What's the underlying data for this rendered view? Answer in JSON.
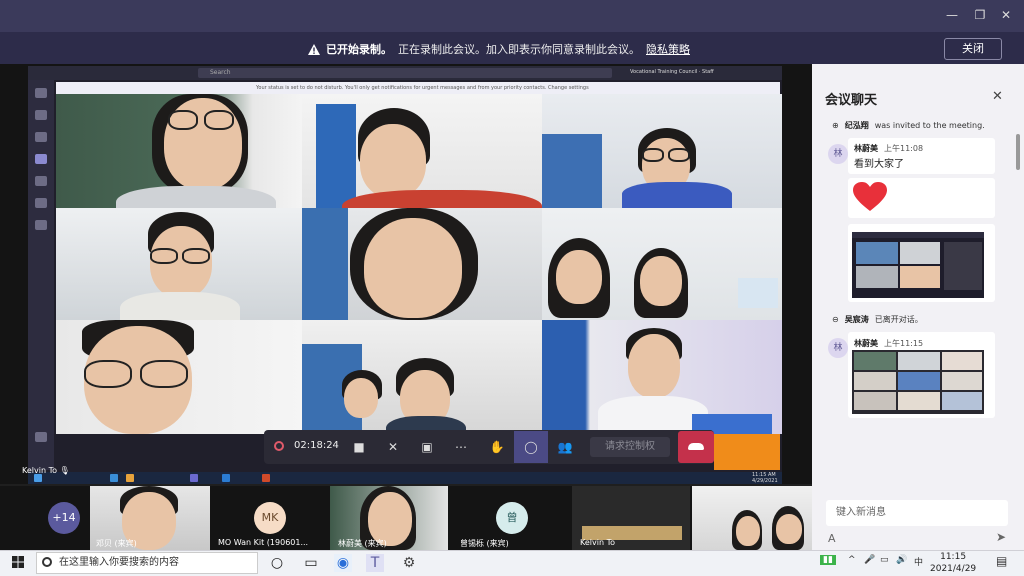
{
  "window": {
    "minimize_icon": "minimize-icon",
    "maximize_icon": "maximize-icon",
    "close_icon": "close-icon"
  },
  "recording_banner": {
    "status": "已开始录制。",
    "message": "正在录制此会议。加入即表示你同意录制此会议。",
    "link": "隐私策略",
    "close_label": "关闭"
  },
  "shared_screen": {
    "search_placeholder": "Search",
    "title": "Vocational Training Council · Staff",
    "notice": "Your status is set to do not disturb. You'll only get notifications for urgent messages and from your priority contacts. Change settings"
  },
  "call": {
    "timer": "02:18:24",
    "request_control_label": "请求控制权",
    "local_user": "Kelvin To"
  },
  "mini_taskbar": {
    "time": "11:15 AM",
    "date": "4/29/2021"
  },
  "gallery": {
    "overflow_count": "+14",
    "participants": [
      {
        "name": "邓贝 (来宾)"
      },
      {
        "initials": "MK",
        "name": "MO Wan Kit (190601..."
      },
      {
        "name": "林蔚美 (来宾)"
      },
      {
        "initials": "曾",
        "name": "曾锡栎 (来宾)"
      },
      {
        "name": "Kelvin To"
      },
      {
        "name": ""
      }
    ]
  },
  "chat": {
    "title": "会议聊天",
    "events": [
      {
        "name": "纪泓翔",
        "text": "was invited to the meeting."
      },
      {
        "name": "吴宸涛",
        "text": "已离开对话。"
      }
    ],
    "messages": [
      {
        "initial": "林",
        "sender": "林蔚美",
        "time": "上午11:08",
        "text": "看到大家了"
      },
      {
        "initial": "林",
        "sender": "林蔚美",
        "time": "上午11:15",
        "text": ""
      }
    ],
    "compose_placeholder": "键入新消息",
    "accent": "#c4314b"
  },
  "taskbar": {
    "search_placeholder": "在这里输入你要搜索的内容",
    "ime": "中",
    "time": "11:15",
    "date": "2021/4/29"
  }
}
